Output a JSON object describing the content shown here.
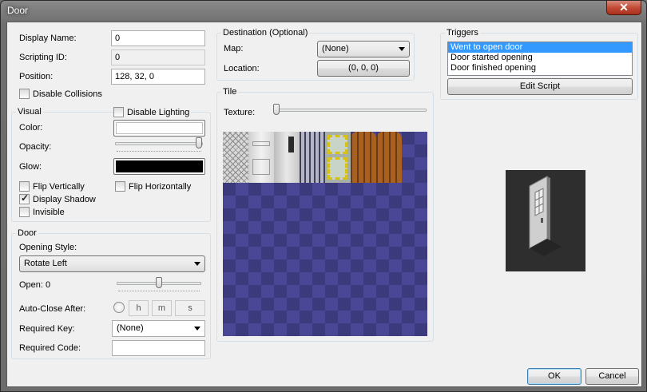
{
  "window": {
    "title": "Door",
    "close_glyph": "✕"
  },
  "general": {
    "display_name_label": "Display Name:",
    "display_name_value": "0",
    "scripting_id_label": "Scripting ID:",
    "scripting_id_value": "0",
    "position_label": "Position:",
    "position_value": "128, 32, 0",
    "disable_collisions_label": "Disable Collisions",
    "disable_collisions_checked": false
  },
  "visual": {
    "group_title": "Visual",
    "disable_lighting_label": "Disable Lighting",
    "disable_lighting_checked": false,
    "color_label": "Color:",
    "color_value": "#ffffff",
    "opacity_label": "Opacity:",
    "opacity_level": 1.0,
    "glow_label": "Glow:",
    "glow_value": "#000000",
    "flip_vertically_label": "Flip Vertically",
    "flip_horizontally_label": "Flip Horizontally",
    "display_shadow_label": "Display Shadow",
    "display_shadow_checked": true,
    "invisible_label": "Invisible"
  },
  "door": {
    "group_title": "Door",
    "opening_style_label": "Opening Style:",
    "opening_style_value": "Rotate Left",
    "open_label": "Open: 0",
    "open_level": 0.5,
    "auto_close_label": "Auto-Close After:",
    "auto_close_h": "h",
    "auto_close_m": "m",
    "auto_close_s": "s",
    "required_key_label": "Required Key:",
    "required_key_value": "(None)",
    "required_code_label": "Required Code:",
    "required_code_value": ""
  },
  "destination": {
    "group_title": "Destination (Optional)",
    "map_label": "Map:",
    "map_value": "(None)",
    "location_label": "Location:",
    "location_value": "(0, 0, 0)"
  },
  "tile": {
    "group_title": "Tile",
    "texture_label": "Texture:",
    "texture_level": 0.0
  },
  "triggers": {
    "group_title": "Triggers",
    "items": [
      "Went to open door",
      "Door started opening",
      "Door finished opening"
    ],
    "selected_index": 0,
    "edit_script_label": "Edit Script"
  },
  "buttons": {
    "ok": "OK",
    "cancel": "Cancel"
  },
  "colors": {
    "selection": "#3399ff",
    "tile_bg_dark": "#3c3a7c",
    "tile_bg_light": "#4a4894",
    "title_text": "#ffffff",
    "close_button": "#c24c38"
  }
}
